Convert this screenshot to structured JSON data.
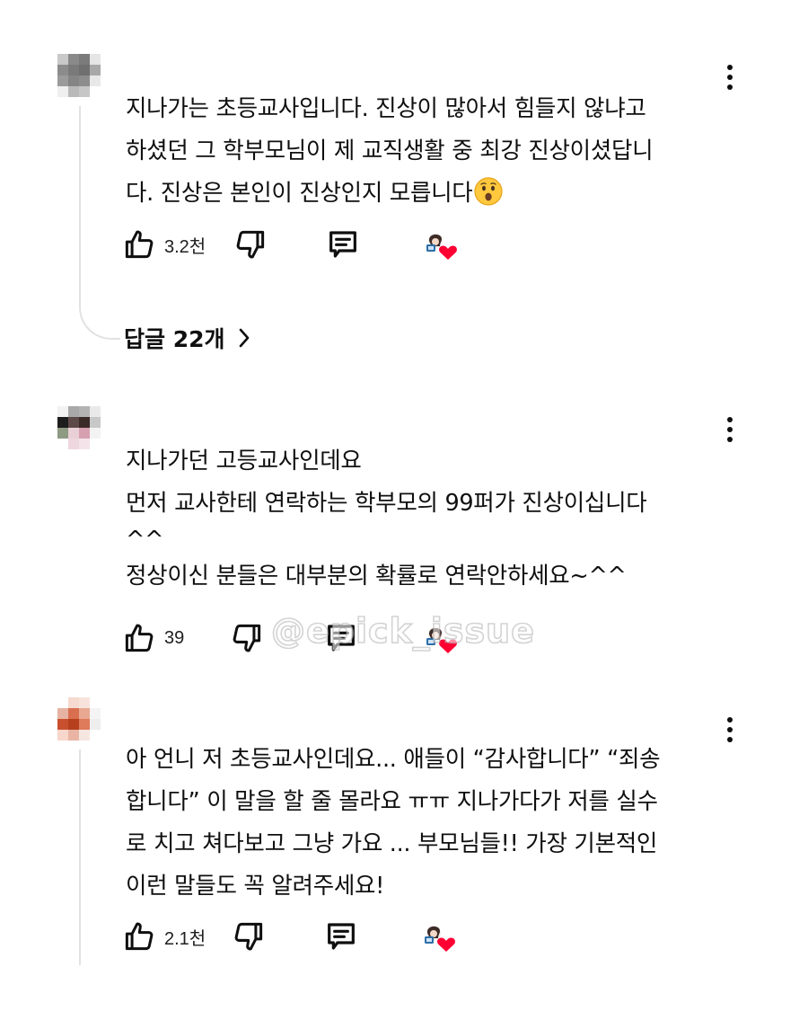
{
  "comments": [
    {
      "username": "",
      "avatar_colors": [
        "#c9c9c9",
        "#8a8a8a",
        "#7b7b7b",
        "#e5e5e5",
        "#8c8c8c",
        "#7a7a7a",
        "#6f6f6f",
        "#a8a8a8",
        "#9b9b9b",
        "#858585",
        "#8d8d8d",
        "#e8e8e8",
        "#efefef",
        "#b9b9b9",
        "#c6c6c6",
        "#ffffff"
      ],
      "lines": [
        "지나가는 초등교사입니다. 진상이 많아서 힘들지 않냐고",
        "하셨던 그 학부모님이 제 교직생활 중 최강 진상이셨답니",
        "다. 진상은 본인이 진상인지 모릅니다"
      ],
      "emoji": "surprised-face",
      "like_count": "3.2천",
      "creator_hearted": true,
      "replies_label": "답글 22개"
    },
    {
      "username": "",
      "avatar_colors": [
        "#f2f2f2",
        "#a9a9a9",
        "#b3b3b3",
        "#e9e9e9",
        "#1d1d1d",
        "#5d4a48",
        "#3a2a28",
        "#c8c8c8",
        "#8f9a83",
        "#e9d0d6",
        "#d7a0b0",
        "#f3f3f3",
        "#ffffff",
        "#efd7df",
        "#f4e4ea",
        "#ffffff"
      ],
      "lines": [
        "지나가던 고등교사인데요",
        "먼저 교사한테 연락하는 학부모의 99퍼가 진상이십니다",
        "^^",
        "정상이신 분들은 대부분의 확률로 연락안하세요~^^"
      ],
      "like_count": "39",
      "creator_hearted": true
    },
    {
      "username": "",
      "avatar_colors": [
        "#ffffff",
        "#f6d9cf",
        "#f8e3dc",
        "#ffffff",
        "#e6b3a3",
        "#d96f4f",
        "#e8a892",
        "#f4f4f4",
        "#c9502e",
        "#b6401e",
        "#df7a5a",
        "#eeeeee",
        "#f7d6cb",
        "#e9b4a4",
        "#f5e6e1",
        "#ffffff"
      ],
      "lines": [
        "아 언니 저 초등교사인데요... 애들이 “감사합니다” “죄송",
        "합니다” 이 말을 할 줄 몰라요 ㅠㅠ 지나가다가 저를 실수",
        "로 치고 쳐다보고 그냥 가요 ... 부모님들!! 가장 기본적인",
        "이런 말들도 꼭 알려주세요!"
      ],
      "like_count": "2.1천",
      "creator_hearted": true
    }
  ],
  "watermark": "@epick_issue",
  "colors": {
    "text": "#0f0f0f",
    "thread_line": "#e2e2e2",
    "heart": "#ff0033"
  }
}
